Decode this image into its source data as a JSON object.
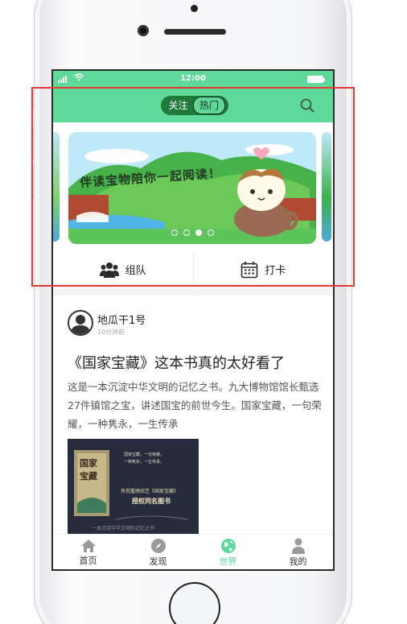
{
  "status": {
    "time": "12:00"
  },
  "header": {
    "tabs": [
      {
        "label": "关注"
      },
      {
        "label": "热门"
      }
    ],
    "active_tab": "热门"
  },
  "banner": {
    "text": "伴读宝物陪你一起阅读！",
    "dots_count": 4,
    "active_dot": 3
  },
  "actions": [
    {
      "label": "组队",
      "icon": "team-icon"
    },
    {
      "label": "打卡",
      "icon": "calendar-icon"
    }
  ],
  "post": {
    "user": "地瓜干1号",
    "time": "10分钟前",
    "title": "《国家宝藏》这本书真的太好看了",
    "body": "这是一本沉淀中华文明的记忆之书。九大博物馆馆长甄选27件镇馆之宝，讲述国宝的前世今生。国家宝藏，一句荣耀，一种隽永，一生传承",
    "cover": {
      "title_1": "国家",
      "title_2": "宝藏",
      "line_1": "国家宝藏，一句荣耀，",
      "line_2": "一种隽永，一生传承。",
      "line_3": "央视重磅综艺《国家宝藏》",
      "line_4": "授权同名图书",
      "footer": "一本沉淀中华文明的记忆之书"
    }
  },
  "tabbar": [
    {
      "label": "首页",
      "icon": "home-icon"
    },
    {
      "label": "发现",
      "icon": "compass-icon"
    },
    {
      "label": "世界",
      "icon": "globe-icon"
    },
    {
      "label": "我的",
      "icon": "user-icon"
    }
  ],
  "active_tab_index": 2,
  "colors": {
    "accent": "#5fd99a",
    "toggle_bg": "#1f7a3a",
    "highlight": "#e53935"
  }
}
